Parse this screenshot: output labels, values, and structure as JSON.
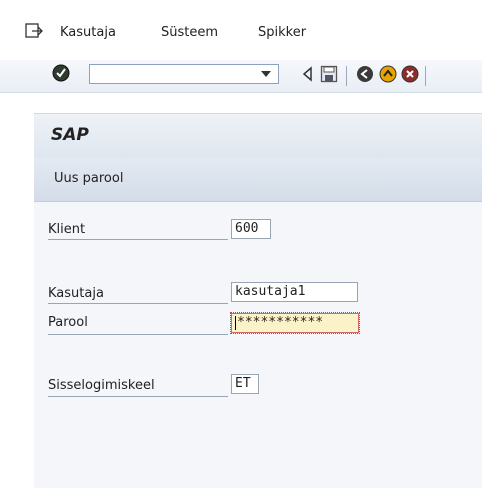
{
  "menubar": {
    "items": [
      {
        "label": "Kasutaja"
      },
      {
        "label": "Süsteem"
      },
      {
        "label": "Spikker"
      }
    ]
  },
  "toolbar": {
    "command_field_value": ""
  },
  "header": {
    "brand": "SAP",
    "screen_title": "Uus parool"
  },
  "form": {
    "client_label": "Klient",
    "client_value": "600",
    "user_label": "Kasutaja",
    "user_value": "kasutaja1",
    "password_label": "Parool",
    "password_value": "***********",
    "language_label": "Sisselogimiskeel",
    "language_value": "ET"
  },
  "colors": {
    "active_field_bg": "#fbf3c7",
    "active_field_border": "#d23b3b"
  }
}
